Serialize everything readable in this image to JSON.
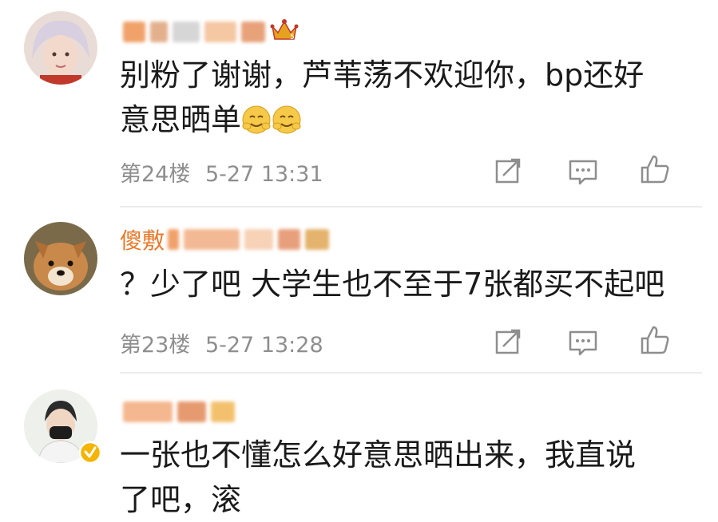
{
  "comments": [
    {
      "username": "",
      "text_line1": "别粉了谢谢，芦苇荡不欢迎你，bp还好",
      "text_line2": "意思晒单",
      "floor": "第24楼",
      "time": "5-27 13:31"
    },
    {
      "username": "傻敷",
      "text_line1": "？少了吧 大学生也不至于7张都买不起吧",
      "floor": "第23楼",
      "time": "5-27 13:28"
    },
    {
      "username": "",
      "text_line1": "一张也不懂怎么好意思晒出来，我直说",
      "text_line2": "了吧，滚"
    }
  ],
  "icons": {
    "share": "share-icon",
    "comment": "comment-icon",
    "like": "like-icon",
    "crown": "crown-icon",
    "verified": "verified-badge-icon",
    "emoji": "hug-emoji-icon"
  },
  "colors": {
    "username": "#e8792b",
    "meta": "#8e8e8e",
    "verified": "#f4b400"
  }
}
